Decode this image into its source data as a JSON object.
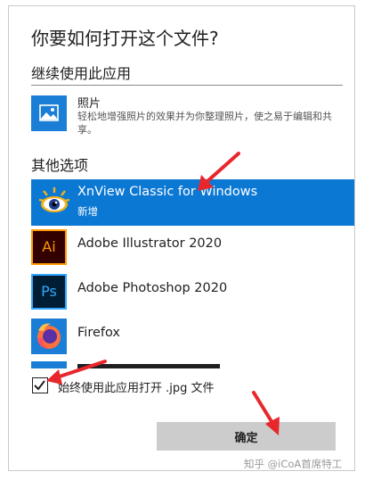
{
  "dialog": {
    "title": "你要如何打开这个文件?",
    "continue_section": "继续使用此应用",
    "other_section": "其他选项",
    "photos": {
      "name": "照片",
      "description": "轻松地增强照片的效果并为你整理照片，使之易于编辑和共享。",
      "icon": "photos-icon"
    },
    "apps": [
      {
        "name": "XnView Classic for Windows",
        "sub": "新增",
        "icon": "xnview-icon",
        "selected": true
      },
      {
        "name": "Adobe Illustrator 2020",
        "icon": "illustrator-icon",
        "icon_text": "Ai"
      },
      {
        "name": "Adobe Photoshop 2020",
        "icon": "photoshop-icon",
        "icon_text": "Ps"
      },
      {
        "name": "Firefox",
        "icon": "firefox-icon"
      }
    ],
    "always_use_label": "始终使用此应用打开 .jpg 文件",
    "always_use_checked": true,
    "ok_label": "确定"
  },
  "colors": {
    "selected_bg": "#0b78d4",
    "arrow": "#e8272c",
    "button_bg": "#cccccc"
  },
  "watermark": "知乎 @iCoA首席特工"
}
